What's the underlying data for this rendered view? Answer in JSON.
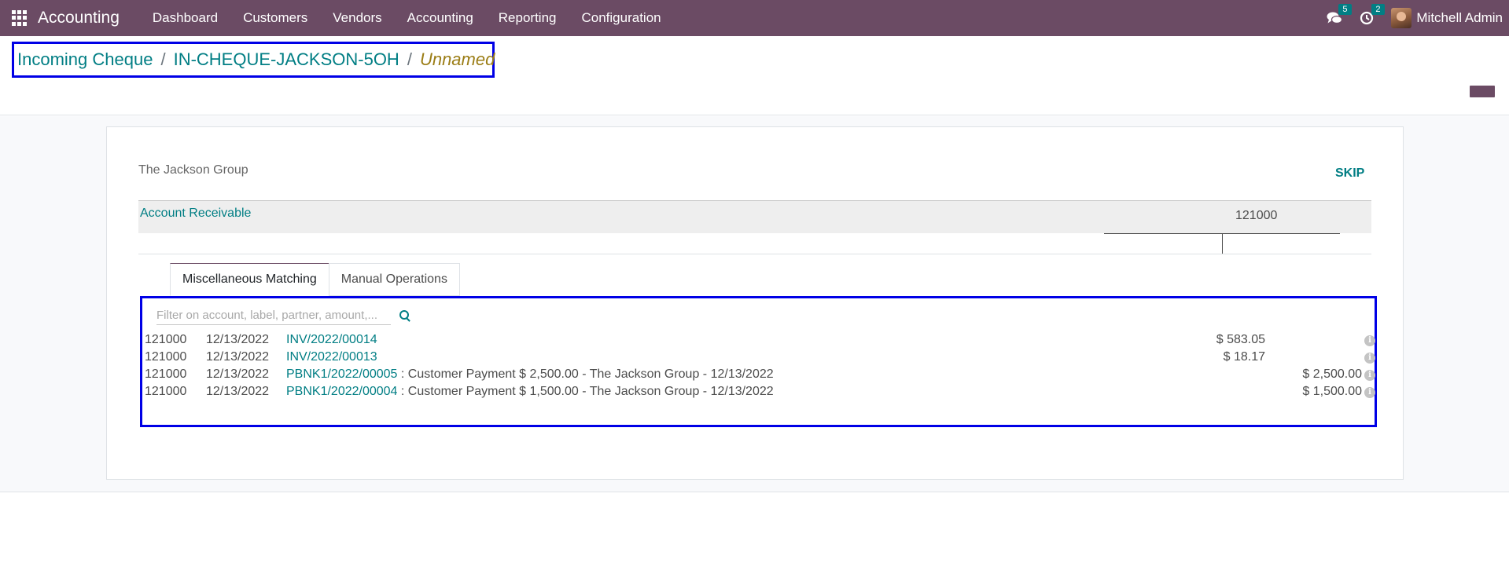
{
  "navbar": {
    "app_name": "Accounting",
    "menu": [
      "Dashboard",
      "Customers",
      "Vendors",
      "Accounting",
      "Reporting",
      "Configuration"
    ],
    "messages_count": "5",
    "activities_count": "2",
    "user_name": "Mitchell Admin",
    "icons": [
      "apps-icon",
      "chat-icon",
      "clock-icon"
    ]
  },
  "breadcrumb": {
    "items": [
      "Incoming Cheque",
      "IN-CHEQUE-JACKSON-5OH"
    ],
    "separator": "/",
    "current": "Unnamed"
  },
  "widget": {
    "partner": "The Jackson Group",
    "skip_label": "SKIP",
    "account_name": "Account Receivable",
    "account_code": "121000",
    "tabs": [
      "Miscellaneous Matching",
      "Manual Operations"
    ],
    "active_tab": "Miscellaneous Matching",
    "filter_placeholder": "Filter on account, label, partner, amount,...",
    "lines": [
      {
        "account": "121000",
        "date": "12/13/2022",
        "ref": "INV/2022/00014",
        "description": "",
        "debit": "$ 583.05",
        "credit": ""
      },
      {
        "account": "121000",
        "date": "12/13/2022",
        "ref": "INV/2022/00013",
        "description": "",
        "debit": "$ 18.17",
        "credit": ""
      },
      {
        "account": "121000",
        "date": "12/13/2022",
        "ref": "PBNK1/2022/00005",
        "description": " : Customer Payment $ 2,500.00 - The Jackson Group - 12/13/2022",
        "debit": "",
        "credit": "$ 2,500.00"
      },
      {
        "account": "121000",
        "date": "12/13/2022",
        "ref": "PBNK1/2022/00004",
        "description": " : Customer Payment $ 1,500.00 - The Jackson Group - 12/13/2022",
        "debit": "",
        "credit": "$ 1,500.00"
      }
    ]
  },
  "colors": {
    "brand": "#6b4b64",
    "link": "#017e84",
    "highlight_border": "#0000e6"
  }
}
